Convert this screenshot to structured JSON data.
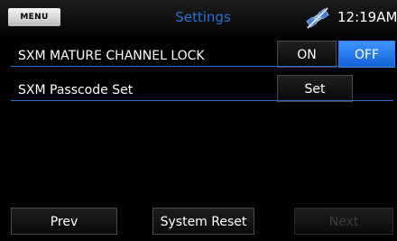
{
  "status_bar": {
    "menu_label": "MENU",
    "title": "Settings",
    "time": "12:19AM",
    "icons": {
      "satellite": "satellite-signal-icon"
    }
  },
  "rows": [
    {
      "label": "SXM MATURE CHANNEL LOCK",
      "options": [
        "ON",
        "OFF"
      ],
      "selected": "OFF"
    },
    {
      "label": "SXM Passcode Set",
      "button": "Set"
    }
  ],
  "footer": {
    "prev_label": "Prev",
    "reset_label": "System Reset",
    "next_label": "Next",
    "next_enabled": false
  },
  "colors": {
    "accent": "#1a6fe6",
    "title": "#2a6fd0",
    "divider": "#2a6fc0"
  }
}
